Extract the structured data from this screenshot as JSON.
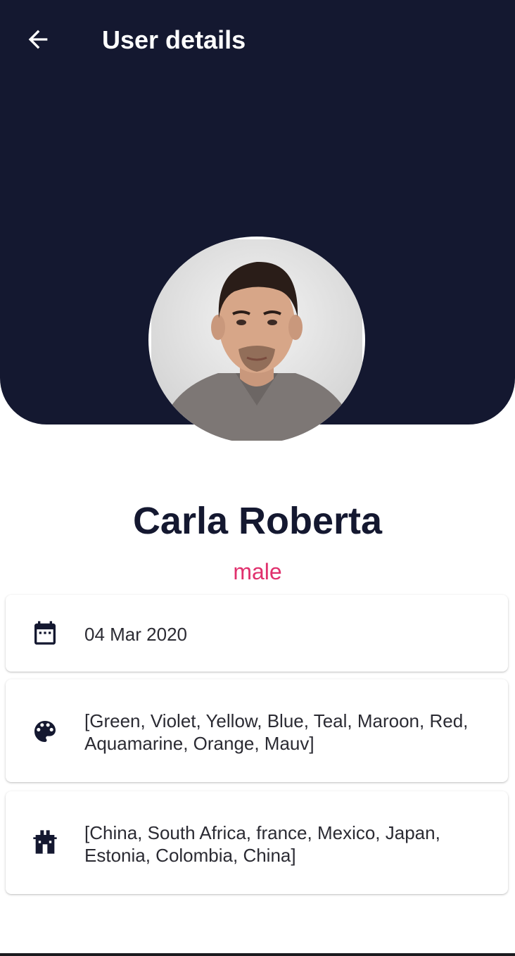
{
  "app_bar": {
    "title": "User details",
    "back_icon": "arrow-back-icon"
  },
  "profile": {
    "name": "Carla Roberta",
    "gender": "male"
  },
  "details": [
    {
      "icon": "calendar-icon",
      "text": "04 Mar 2020"
    },
    {
      "icon": "palette-icon",
      "text": "[Green, Violet, Yellow, Blue, Teal, Maroon, Red, Aquamarine, Orange, Mauv]"
    },
    {
      "icon": "hotel-icon",
      "text": "[China, South Africa, france, Mexico, Japan, Estonia, Colombia, China]"
    }
  ],
  "colors": {
    "header_bg": "#141830",
    "accent": "#e0306d",
    "name": "#141830"
  }
}
